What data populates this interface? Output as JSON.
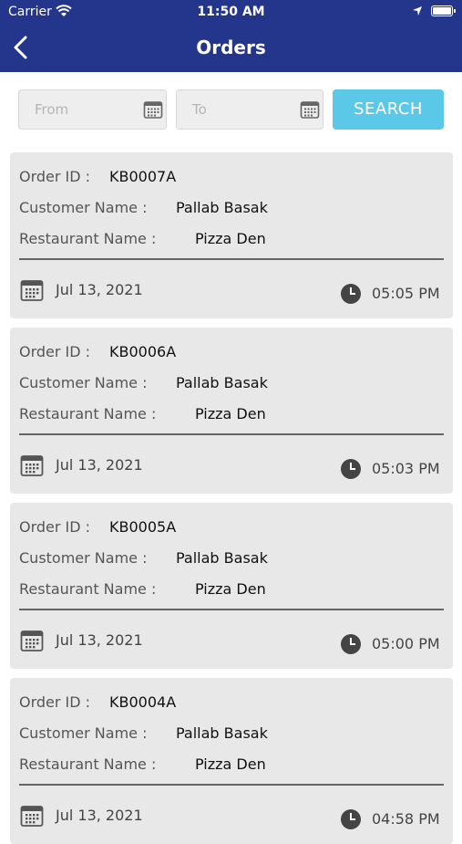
{
  "status_bar": {
    "carrier": "Carrier",
    "time": "11:50 AM"
  },
  "header": {
    "title": "Orders"
  },
  "filters": {
    "from_placeholder": "From",
    "to_placeholder": "To",
    "search_label": "SEARCH"
  },
  "labels": {
    "order_id": "Order ID :",
    "customer_name": "Customer Name :",
    "restaurant_name": "Restaurant Name :"
  },
  "orders": [
    {
      "id": "KB0007A",
      "customer": "Pallab Basak",
      "restaurant": "Pizza Den",
      "date": "Jul 13, 2021",
      "time": "05:05 PM"
    },
    {
      "id": "KB0006A",
      "customer": "Pallab Basak",
      "restaurant": "Pizza Den",
      "date": "Jul 13, 2021",
      "time": "05:03 PM"
    },
    {
      "id": "KB0005A",
      "customer": "Pallab Basak",
      "restaurant": "Pizza Den",
      "date": "Jul 13, 2021",
      "time": "05:00 PM"
    },
    {
      "id": "KB0004A",
      "customer": "Pallab Basak",
      "restaurant": "Pizza Den",
      "date": "Jul 13, 2021",
      "time": "04:58 PM"
    }
  ]
}
